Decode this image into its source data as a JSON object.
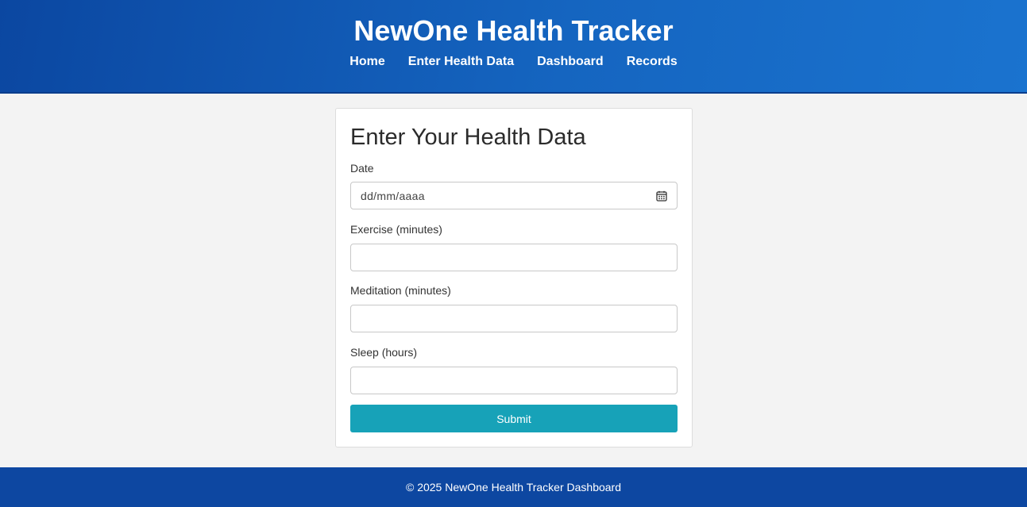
{
  "header": {
    "title": "NewOne Health Tracker",
    "nav": [
      {
        "label": "Home"
      },
      {
        "label": "Enter Health Data"
      },
      {
        "label": "Dashboard"
      },
      {
        "label": "Records"
      }
    ],
    "gradient_colors": [
      "#0b47a1",
      "#1a73cf"
    ]
  },
  "form": {
    "title": "Enter Your Health Data",
    "fields": {
      "date": {
        "label": "Date",
        "placeholder": "dd/mm/aaaa",
        "icon": "calendar-icon"
      },
      "exercise": {
        "label": "Exercise (minutes)",
        "value": ""
      },
      "meditation": {
        "label": "Meditation (minutes)",
        "value": ""
      },
      "sleep": {
        "label": "Sleep (hours)",
        "value": ""
      }
    },
    "submit_label": "Submit",
    "submit_color": "#17a2b8"
  },
  "footer": {
    "text": "© 2025 NewOne Health Tracker Dashboard",
    "color": "#0d47a1"
  }
}
